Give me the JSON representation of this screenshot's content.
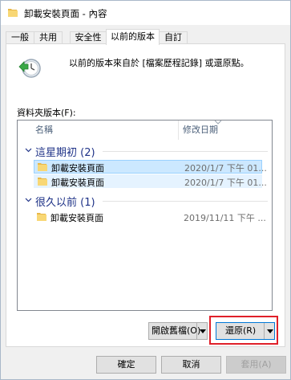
{
  "window": {
    "title": "卸載安裝頁面 - 內容"
  },
  "tabs": [
    {
      "label": "一般",
      "active": false
    },
    {
      "label": "共用",
      "active": false
    },
    {
      "label": "安全性",
      "active": false
    },
    {
      "label": "以前的版本",
      "active": true
    },
    {
      "label": "自訂",
      "active": false
    }
  ],
  "header": {
    "description": "以前的版本來自於 [檔案歷程記錄] 或還原點。"
  },
  "list": {
    "label": "資料夾版本(F):",
    "columns": {
      "name": "名稱",
      "date": "修改日期"
    },
    "groups": [
      {
        "title": "這星期初 (2)",
        "items": [
          {
            "name": "卸載安裝頁面",
            "date": "2020/1/7 下午 01..."
          },
          {
            "name": "卸載安裝頁面",
            "date": "2020/1/7 下午 01..."
          }
        ]
      },
      {
        "title": "很久以前 (1)",
        "items": [
          {
            "name": "卸載安裝頁面",
            "date": "2019/11/11 下午 ..."
          }
        ]
      }
    ]
  },
  "actions": {
    "open": "開啟舊檔(O)",
    "restore": "還原(R)"
  },
  "footer": {
    "ok": "確定",
    "cancel": "取消",
    "apply": "套用(A)"
  },
  "colors": {
    "accent_highlight": "#e0202a",
    "selection": "#cce8ff",
    "group_text": "#1e3287"
  }
}
